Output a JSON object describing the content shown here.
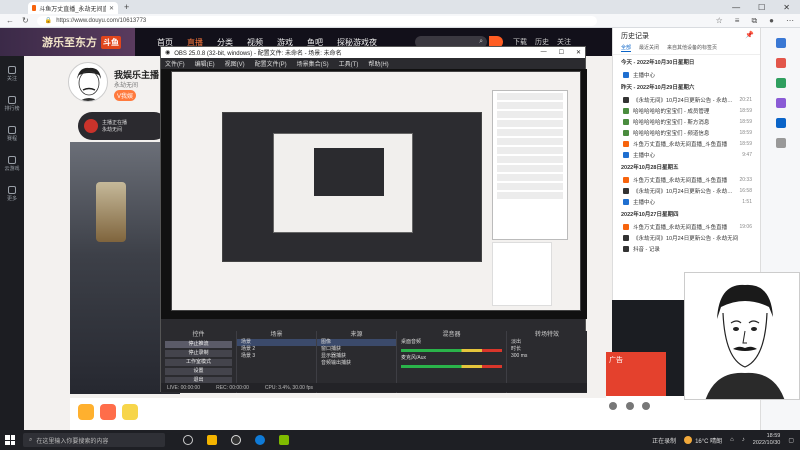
{
  "browser": {
    "tab_title": "斗鱼万丈直播_永劫无间直播_永劫...",
    "url": "https://www.douyu.com/10613773",
    "window_controls": [
      "—",
      "☐",
      "✕"
    ]
  },
  "douyu": {
    "logo_text": "游乐至东方",
    "logo_badge": "斗鱼",
    "nav": [
      "首页",
      "直播",
      "分类",
      "视频",
      "游戏",
      "鱼吧",
      "探秘游戏夜"
    ],
    "active_nav": "直播",
    "vip_label": "秘境神速",
    "header_icons": [
      "下载",
      "历史",
      "关注"
    ],
    "sidebar": [
      "关注",
      "排行榜",
      "赛程",
      "云游戏",
      "更多"
    ],
    "streamer": {
      "name": "我娱乐主播",
      "room_id": "",
      "category": "永劫无间",
      "badge": "V我娱"
    },
    "anchor_pill": {
      "line1": "主播正在播",
      "line2": "永劫无间"
    }
  },
  "obs": {
    "title": "OBS 25.0.8 (32-bit, windows) - 配置文件: 未命名 - 场景: 未命名",
    "menu": [
      "文件(F)",
      "编辑(E)",
      "视图(V)",
      "配置文件(P)",
      "场景集合(S)",
      "工具(T)",
      "帮助(H)"
    ],
    "docks": {
      "controls_title": "控件",
      "controls": [
        "停止推流",
        "停止录制",
        "工作室模式",
        "设置",
        "退出"
      ],
      "scenes_title": "场景",
      "scenes": [
        "场景",
        "场景 2",
        "场景 3"
      ],
      "sources_title": "来源",
      "sources": [
        "图像",
        "窗口捕获",
        "显示器捕获",
        "音频输出捕获"
      ],
      "mixer_title": "混音器",
      "mixer": [
        "桌面音频",
        "麦克风/Aux"
      ],
      "transitions_title": "转场特效",
      "transition_value": "淡出",
      "duration_label": "时长",
      "duration_value": "300 ms"
    },
    "status": [
      "LIVE: 00:00:00",
      "REC: 00:00:00",
      "CPU: 3.4%, 30.00 fps"
    ]
  },
  "history": {
    "title": "历史记录",
    "tabs": [
      "全部",
      "最近关闭",
      "来自其他设备的标签页"
    ],
    "groups": [
      {
        "date": "今天 - 2022年10月30日星期日",
        "items": [
          {
            "t": "主播中心",
            "time": "",
            "c": "b"
          }
        ]
      },
      {
        "date": "昨天 - 2022年10月29日星期六",
        "items": [
          {
            "t": "《永劫无间》10月24日更新公告 - 永劫无间",
            "time": "20:21",
            "c": "k"
          },
          {
            "t": "哈哈哈哈哈的宝宝们 - 成员管理",
            "time": "18:59",
            "c": "g"
          },
          {
            "t": "哈哈哈哈哈的宝宝们 - 斯方消息",
            "time": "18:59",
            "c": "g"
          },
          {
            "t": "哈哈哈哈哈的宝宝们 - 频道信息",
            "time": "18:59",
            "c": "g"
          },
          {
            "t": "斗鱼万丈直播_永劫无间直播_斗鱼直播",
            "time": "18:59",
            "c": ""
          },
          {
            "t": "主播中心",
            "time": "9:47",
            "c": "b"
          }
        ]
      },
      {
        "date": "2022年10月28日星期五",
        "items": [
          {
            "t": "斗鱼万丈直播_永劫无间直播_斗鱼直播",
            "time": "20:33",
            "c": ""
          },
          {
            "t": "《永劫无间》10月24日更新公告 - 永劫无间",
            "time": "16:58",
            "c": "k"
          },
          {
            "t": "主播中心",
            "time": "1:51",
            "c": "b"
          }
        ]
      },
      {
        "date": "2022年10月27日星期四",
        "items": [
          {
            "t": "斗鱼万丈直播_永劫无间直播_斗鱼直播",
            "time": "19:06",
            "c": ""
          },
          {
            "t": "《永劫无间》10月24日更新公告 - 永劫无间",
            "time": "",
            "c": "k"
          },
          {
            "t": "抖音 - 记录",
            "time": "",
            "c": "k"
          }
        ]
      }
    ]
  },
  "ad": {
    "text": "广告"
  },
  "taskbar": {
    "search_placeholder": "在这里输入你要搜索的内容",
    "tray_text": "正在录制",
    "weather": "16°C 晴朗",
    "time": "18:59",
    "date": "2022/10/30"
  }
}
